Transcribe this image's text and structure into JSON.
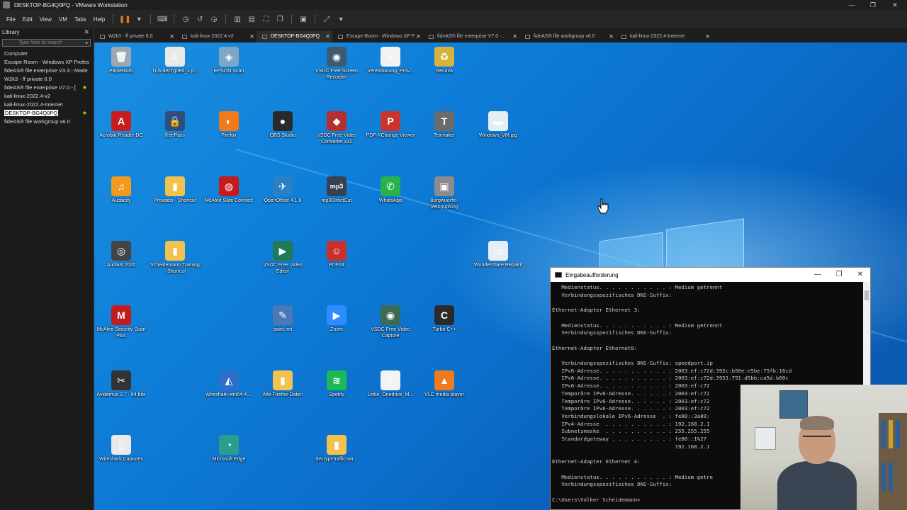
{
  "window": {
    "title": "DESKTOP-BG4Q0PQ - VMware Workstation",
    "controls": [
      "—",
      "❐",
      "✕"
    ]
  },
  "menubar": {
    "items": [
      "File",
      "Edit",
      "View",
      "VM",
      "Tabs",
      "Help"
    ]
  },
  "library": {
    "title": "Library",
    "close": "✕",
    "search_placeholder": "Type here to search",
    "root": "Computer",
    "items": [
      {
        "label": "Escape Room - Windows XP Profes",
        "favorite": false,
        "selected": false
      },
      {
        "label": "fideAS® file enterprise V3.3 - Made",
        "favorite": false,
        "selected": false
      },
      {
        "label": "W2k3 - ff private 6.0",
        "favorite": false,
        "selected": false
      },
      {
        "label": "fideAS® file enterprise V7.0 - [",
        "favorite": true,
        "selected": false
      },
      {
        "label": "kali-linux-2022.4-v2",
        "favorite": false,
        "selected": false
      },
      {
        "label": "kali-linux-2022.4-Internet",
        "favorite": false,
        "selected": false
      },
      {
        "label": "DESKTOP-BG4Q0PQ",
        "favorite": true,
        "selected": true
      },
      {
        "label": "fideAS® file workgroup v6.0",
        "favorite": false,
        "selected": false
      }
    ]
  },
  "tabs": [
    {
      "label": "W2k3 - ff private 6.0",
      "active": false
    },
    {
      "label": "kali-linux-2022.4-v2",
      "active": false
    },
    {
      "label": "DESKTOP-BG4Q0PQ",
      "active": true
    },
    {
      "label": "Escape Room - Windows XP P...",
      "active": false
    },
    {
      "label": "fideAS® file enterprise V7.0 -...",
      "active": false
    },
    {
      "label": "fideAS® file workgroup v6.0",
      "active": false
    },
    {
      "label": "kali-linux-2022.4-Internet",
      "active": false
    }
  ],
  "desktop": {
    "icons": [
      {
        "label": "Papierkorb",
        "glyph": "🗑",
        "color": "#9aa8b3"
      },
      {
        "label": "TLS-decrypted_1.p...",
        "glyph": "≡",
        "color": "#e9e9e9"
      },
      {
        "label": "EPSON Scan",
        "glyph": "◈",
        "color": "#7ea6c6"
      },
      {
        "label": "VSDC Free Screen Recorder",
        "glyph": "◉",
        "color": "#3c5a70"
      },
      {
        "label": "Vereinbarung_Prov...",
        "glyph": "≡",
        "color": "#f2f2f2"
      },
      {
        "label": "Recuva",
        "glyph": "♻",
        "color": "#d8b23a"
      },
      {
        "label": "Acrobat Reader DC",
        "glyph": "A",
        "color": "#c81d1d"
      },
      {
        "label": "KeePass",
        "glyph": "🔒",
        "color": "#2f4e7b"
      },
      {
        "label": "Firefox",
        "glyph": "◐",
        "color": "#f07a1c"
      },
      {
        "label": "OBS Studio",
        "glyph": "●",
        "color": "#2a2a2a"
      },
      {
        "label": "VSDC Free Video Converter x32",
        "glyph": "◆",
        "color": "#b52f2f"
      },
      {
        "label": "PDF-XChange Viewer",
        "glyph": "P",
        "color": "#c8352e"
      },
      {
        "label": "Texmaker",
        "glyph": "T",
        "color": "#6b6b6b"
      },
      {
        "label": "Windows_VM.jpg",
        "glyph": "▬",
        "color": "#e6eef5"
      },
      {
        "label": "Audacity",
        "glyph": "♫",
        "color": "#f29a1c"
      },
      {
        "label": "Provadis - Shortcut",
        "glyph": "▮",
        "color": "#f2c14e"
      },
      {
        "label": "McAfee Safe Connect",
        "glyph": "◍",
        "color": "#c41c1c"
      },
      {
        "label": "OpenOffice 4.1.6",
        "glyph": "✈",
        "color": "#2b7fc4"
      },
      {
        "label": "mp3DirectCut",
        "glyph": "mp3",
        "color": "#36424f"
      },
      {
        "label": "WhatsApp",
        "glyph": "✆",
        "color": "#29b24a"
      },
      {
        "label": "Borgwuerfel-Verknüpfung",
        "glyph": "▣",
        "color": "#8b8b8b"
      },
      {
        "label": "Audials 2020",
        "glyph": "◎",
        "color": "#444"
      },
      {
        "label": "Scheidemann Training - Shortcut",
        "glyph": "▮",
        "color": "#f2c14e"
      },
      {
        "label": "VSDC Free Video Editor",
        "glyph": "▶",
        "color": "#1f7a58"
      },
      {
        "label": "PDF24",
        "glyph": "☺",
        "color": "#c9302c"
      },
      {
        "label": "Wondershare Repairit",
        "glyph": "▭",
        "color": "#e8eef5"
      },
      {
        "label": "McAfee Security Scan Plus",
        "glyph": "M",
        "color": "#c41c1c"
      },
      {
        "label": "paint.net",
        "glyph": "✎",
        "color": "#4a79b5"
      },
      {
        "label": "Zoom",
        "glyph": "▶",
        "color": "#2d8cff"
      },
      {
        "label": "VSDC Free Video Capture",
        "glyph": "◉",
        "color": "#3c6a52"
      },
      {
        "label": "Turbo C++",
        "glyph": "C",
        "color": "#2a2a2a"
      },
      {
        "label": "Avidemux 2.7 - 64 bits",
        "glyph": "✂",
        "color": "#333"
      },
      {
        "label": "Wireshark-win64-4....",
        "glyph": "◭",
        "color": "#2e6fc9"
      },
      {
        "label": "Alte Firefox-Daten",
        "glyph": "▮",
        "color": "#f2c14e"
      },
      {
        "label": "Spotify",
        "glyph": "≋",
        "color": "#1db954"
      },
      {
        "label": "Linke_Onedrive_M...",
        "glyph": "≡",
        "color": "#f2f2f2"
      },
      {
        "label": "VLC media player",
        "glyph": "▲",
        "color": "#f07a1c"
      },
      {
        "label": "Wireshark Captures",
        "glyph": "▯",
        "color": "#e9e9e9"
      },
      {
        "label": "Microsoft Edge",
        "glyph": "◔",
        "color": "#2a9d8f"
      },
      {
        "label": "decrypt-traffic-wir...",
        "glyph": "▮",
        "color": "#f2c14e"
      }
    ]
  },
  "cmd": {
    "title": "Eingabeaufforderung",
    "lines": [
      "   Medienstatus. . . . . . . . . . . : Medium getrennt",
      "   Verbindungsspezifisches DNS-Suffix:",
      "",
      "Ethernet-Adapter Ethernet 3:",
      "",
      "   Medienstatus. . . . . . . . . . . : Medium getrennt",
      "   Verbindungsspezifisches DNS-Suffix:",
      "",
      "Ethernet-Adapter Ethernet0:",
      "",
      "   Verbindungsspezifisches DNS-Suffix: speedport.ip",
      "   IPv6-Adresse. . . . . . . . . . . : 2003:ef:c72d:392c:b50e:e5be:75fb:16cd",
      "   IPv6-Adresse. . . . . . . . . . . : 2003:ef:c72d:3951:791:d5bb:ca5d:b00c",
      "   IPv6-Adresse. . . . . . . . . . . : 2003:ef:c72",
      "   Temporäre IPv6-Adresse. . . . . . : 2003:ef:c72",
      "   Temporäre IPv6-Adresse. . . . . . : 2003:ef:c72",
      "   Temporäre IPv6-Adresse. . . . . . : 2003:ef:c72",
      "   Verbindungslokale IPv6-Adresse  . : fe80::3a89:",
      "   IPv4-Adresse  . . . . . . . . . . : 192.168.2.1",
      "   Subnetzmaske  . . . . . . . . . . : 255.255.255",
      "   Standardgateway . . . . . . . . . : fe80::1%27",
      "                                       192.168.2.1",
      "",
      "Ethernet-Adapter Ethernet 4:",
      "",
      "   Medienstatus. . . . . . . . . . . : Medium getre",
      "   Verbindungsspezifisches DNS-Suffix:",
      "",
      "C:\\Users\\Volker Scheidemann>"
    ]
  }
}
